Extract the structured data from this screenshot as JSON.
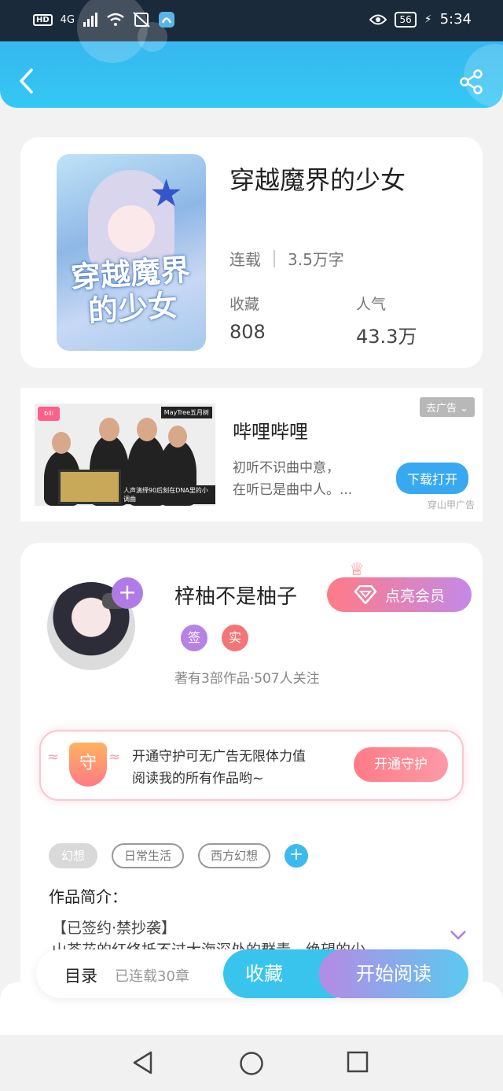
{
  "status_bar": {
    "network": "4G",
    "hd": "HD",
    "battery": "56",
    "time": "5:34"
  },
  "header": {
    "back_icon": "back-arrow-icon",
    "share_icon": "share-icon"
  },
  "book": {
    "title": "穿越魔界的少女",
    "cover_title": "穿越魔界的少女",
    "status": "连载",
    "word_count": "3.5万字",
    "favorites_label": "收藏",
    "favorites_value": "808",
    "popularity_label": "人气",
    "popularity_value": "43.3万"
  },
  "ad": {
    "title": "哔哩哔哩",
    "desc_line1": "初听不识曲中意，",
    "desc_line2": "在听已是曲中人。...",
    "close_label": "去广告",
    "button_label": "下载打开",
    "source": "穿山甲广告",
    "banner_text": "MayTree五月树",
    "caption_text": "人声演绎90后刻在DNA里的小调曲"
  },
  "author": {
    "name": "梓柚不是柚子",
    "vip_label": "点亮会员",
    "badge_sign": "签",
    "badge_real": "实",
    "stats": "著有3部作品·507人关注",
    "guard_line1": "开通守护可无广告无限体力值",
    "guard_line2": "阅读我的所有作品哟~",
    "guard_badge": "守",
    "guard_button": "开通守护"
  },
  "tags": [
    "幻想",
    "日常生活",
    "西方幻想"
  ],
  "intro": {
    "label": "作品简介：",
    "line1": "【已签约·禁抄袭】",
    "line2": "山茶花的红终抵不过大海深处的群青，绝望的少"
  },
  "bottom_bar": {
    "toc_label": "目录",
    "chapters": "已连载30章",
    "favorite_button": "收藏",
    "read_button": "开始阅读"
  },
  "colors": {
    "header_blue": "#33c8f4",
    "accent_purple": "#b07be6",
    "accent_pink": "#ff7b86"
  }
}
